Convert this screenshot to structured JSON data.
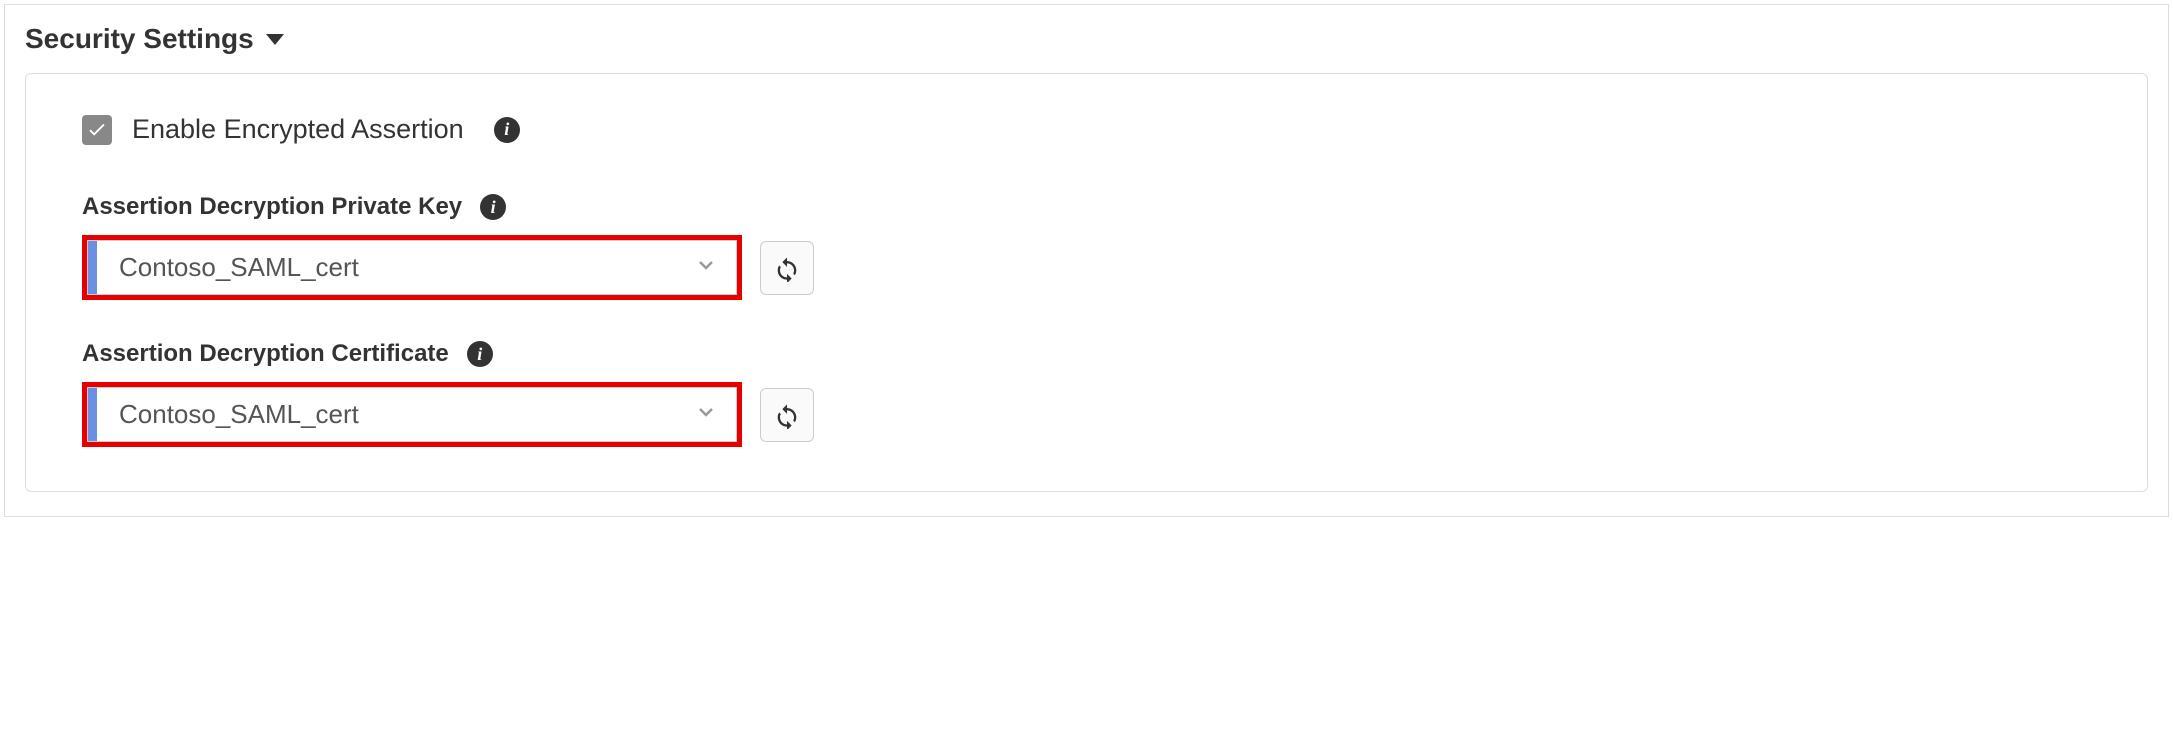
{
  "section": {
    "title": "Security Settings"
  },
  "checkbox": {
    "label": "Enable Encrypted Assertion",
    "checked": true
  },
  "fields": {
    "privateKey": {
      "label": "Assertion Decryption Private Key",
      "value": "Contoso_SAML_cert"
    },
    "certificate": {
      "label": "Assertion Decryption Certificate",
      "value": "Contoso_SAML_cert"
    }
  }
}
